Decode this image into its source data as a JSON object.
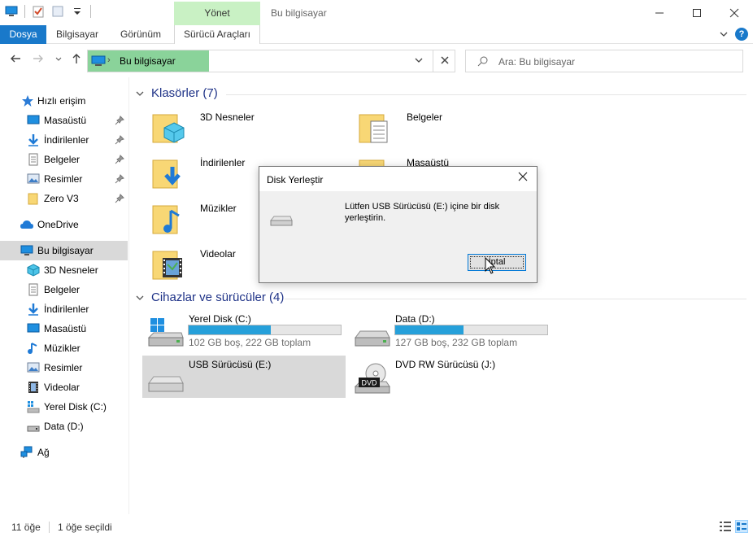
{
  "window": {
    "title": "Bu bilgisayar",
    "context_tab_header": "Yönet"
  },
  "ribbon": {
    "tabs": [
      {
        "label": "Dosya"
      },
      {
        "label": "Bilgisayar"
      },
      {
        "label": "Görünüm"
      },
      {
        "label": "Sürücü Araçları"
      }
    ]
  },
  "address": {
    "path": "Bu bilgisayar",
    "search_placeholder": "Ara: Bu bilgisayar"
  },
  "sidebar": {
    "quick_access": "Hızlı erişim",
    "quick_items": [
      {
        "label": "Masaüstü",
        "icon": "desktop-icon"
      },
      {
        "label": "İndirilenler",
        "icon": "downloads-icon"
      },
      {
        "label": "Belgeler",
        "icon": "documents-icon"
      },
      {
        "label": "Resimler",
        "icon": "pictures-icon"
      },
      {
        "label": "Zero V3",
        "icon": "folder-icon"
      }
    ],
    "onedrive": "OneDrive",
    "this_pc": "Bu bilgisayar",
    "pc_items": [
      {
        "label": "3D Nesneler",
        "icon": "3d-objects-icon"
      },
      {
        "label": "Belgeler",
        "icon": "documents-icon"
      },
      {
        "label": "İndirilenler",
        "icon": "downloads-icon"
      },
      {
        "label": "Masaüstü",
        "icon": "desktop-icon"
      },
      {
        "label": "Müzikler",
        "icon": "music-icon"
      },
      {
        "label": "Resimler",
        "icon": "pictures-icon"
      },
      {
        "label": "Videolar",
        "icon": "videos-icon"
      },
      {
        "label": "Yerel Disk (C:)",
        "icon": "windows-drive-icon"
      },
      {
        "label": "Data (D:)",
        "icon": "drive-icon"
      }
    ],
    "network": "Ağ"
  },
  "main": {
    "folders_header": "Klasörler (7)",
    "folders": [
      {
        "label": "3D Nesneler",
        "icon": "3d-objects-folder-icon"
      },
      {
        "label": "Belgeler",
        "icon": "documents-folder-icon"
      },
      {
        "label": "İndirilenler",
        "icon": "downloads-folder-icon"
      },
      {
        "label": "Masaüstü",
        "icon": "desktop-folder-icon"
      },
      {
        "label": "Müzikler",
        "icon": "music-folder-icon"
      },
      {
        "label": "Videolar",
        "icon": "videos-folder-icon"
      }
    ],
    "devices_header": "Cihazlar ve sürücüler (4)",
    "drives": [
      {
        "label": "Yerel Disk (C:)",
        "free_text": "102 GB boş, 222 GB toplam",
        "used_fraction": 0.54
      },
      {
        "label": "Data (D:)",
        "free_text": "127 GB boş, 232 GB toplam",
        "used_fraction": 0.45
      },
      {
        "label": "USB Sürücüsü (E:)"
      },
      {
        "label": "DVD RW Sürücüsü (J:)",
        "badge": "DVD"
      }
    ]
  },
  "status": {
    "count": "11 öğe",
    "selected": "1 öğe seçildi"
  },
  "dialog": {
    "title": "Disk Yerleştir",
    "message": "Lütfen USB Sürücüsü (E:) içine bir disk yerleştirin.",
    "cancel_label": "İptal"
  },
  "colors": {
    "accent": "#1979ca",
    "context_tab": "#c9f1c4",
    "address_highlight": "#8ad39a",
    "usage_bar": "#26a0da",
    "group_header": "#1e3287"
  }
}
